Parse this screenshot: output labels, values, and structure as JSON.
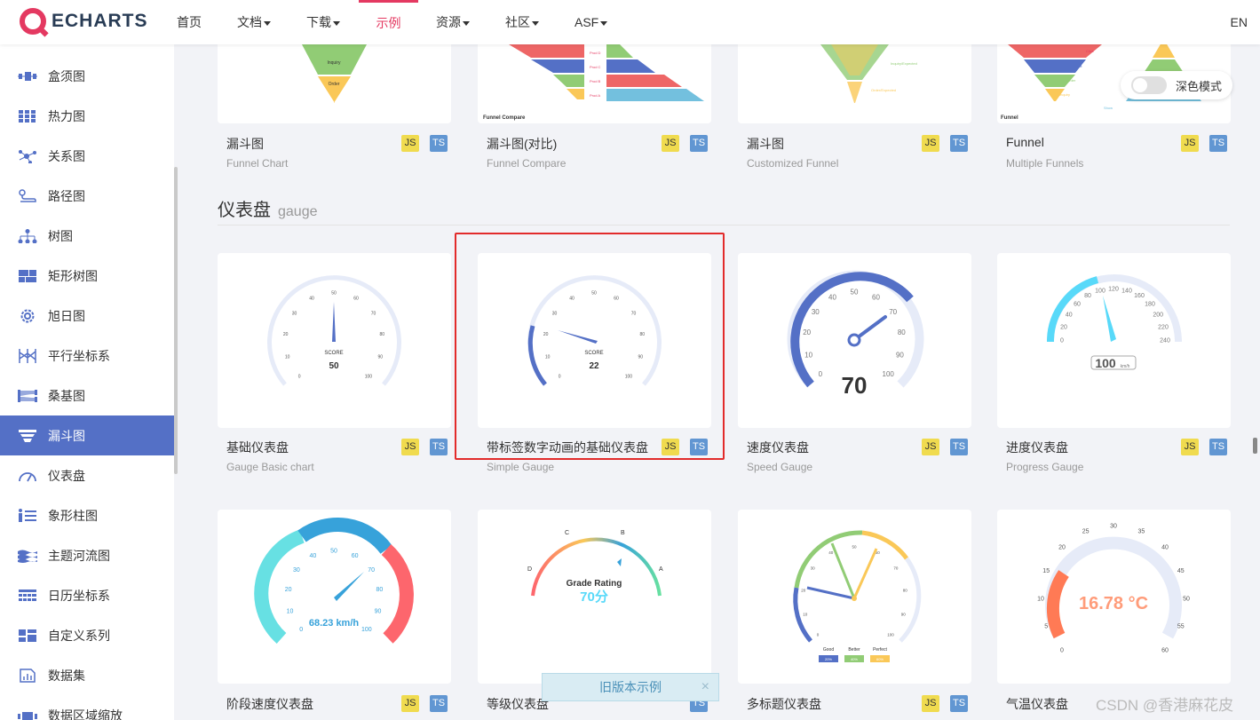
{
  "nav": {
    "logo": "ECHARTS",
    "items": [
      {
        "label": "首页"
      },
      {
        "label": "文档"
      },
      {
        "label": "下载"
      },
      {
        "label": "示例"
      },
      {
        "label": "资源"
      },
      {
        "label": "社区"
      },
      {
        "label": "ASF"
      }
    ],
    "active": "示例",
    "lang": "EN"
  },
  "sidebar": {
    "items": [
      {
        "label": "盒须图",
        "icon": "boxplot-icon"
      },
      {
        "label": "热力图",
        "icon": "heatmap-icon"
      },
      {
        "label": "关系图",
        "icon": "graph-icon"
      },
      {
        "label": "路径图",
        "icon": "lines-icon"
      },
      {
        "label": "树图",
        "icon": "tree-icon"
      },
      {
        "label": "矩形树图",
        "icon": "treemap-icon"
      },
      {
        "label": "旭日图",
        "icon": "sunburst-icon"
      },
      {
        "label": "平行坐标系",
        "icon": "parallel-icon"
      },
      {
        "label": "桑基图",
        "icon": "sankey-icon"
      },
      {
        "label": "漏斗图",
        "icon": "funnel-icon"
      },
      {
        "label": "仪表盘",
        "icon": "gauge-icon"
      },
      {
        "label": "象形柱图",
        "icon": "pictorial-bar-icon"
      },
      {
        "label": "主题河流图",
        "icon": "theme-river-icon"
      },
      {
        "label": "日历坐标系",
        "icon": "calendar-icon"
      },
      {
        "label": "自定义系列",
        "icon": "custom-icon"
      },
      {
        "label": "数据集",
        "icon": "dataset-icon"
      },
      {
        "label": "数据区域缩放",
        "icon": "datazoom-icon"
      }
    ],
    "active": "漏斗图"
  },
  "dark_mode": {
    "label": "深色模式",
    "on": false
  },
  "badges": {
    "js": "JS",
    "ts": "TS"
  },
  "funnel_cards": [
    {
      "title": "漏斗图",
      "subtitle": "Funnel Chart",
      "labels": [
        "Inquiry",
        "Order"
      ]
    },
    {
      "title": "漏斗图(对比)",
      "subtitle": "Funnel Compare",
      "chart_title": "Funnel Compare",
      "labels": [
        "Prod D",
        "Prod C",
        "Prod B",
        "Prod A"
      ]
    },
    {
      "title": "漏斗图",
      "subtitle": "Customized Funnel",
      "labels": [
        "Inquiry/Expected",
        "Order/Expected"
      ]
    },
    {
      "title": "Funnel",
      "subtitle": "Multiple Funnels",
      "chart_title": "Funnel",
      "labels": [
        "Click",
        "Visit",
        "Order",
        "Inquiry",
        "Show"
      ]
    }
  ],
  "section": {
    "title": "仪表盘",
    "subtitle": "gauge"
  },
  "gauge_cards_row1": [
    {
      "title": "基础仪表盘",
      "subtitle": "Gauge Basic chart",
      "label": "SCORE",
      "value": "50"
    },
    {
      "title": "带标签数字动画的基础仪表盘",
      "subtitle": "Simple Gauge",
      "label": "SCORE",
      "value": "22"
    },
    {
      "title": "速度仪表盘",
      "subtitle": "Speed Gauge",
      "value": "70"
    },
    {
      "title": "进度仪表盘",
      "subtitle": "Progress Gauge",
      "value": "100",
      "unit": "km/h"
    }
  ],
  "gauge_cards_row2": [
    {
      "title": "阶段速度仪表盘",
      "value": "68.23 km/h"
    },
    {
      "title": "等级仪表盘",
      "label": "Grade Rating",
      "value": "70分",
      "grades": [
        "D",
        "C",
        "B",
        "A"
      ]
    },
    {
      "title": "多标题仪表盘",
      "legend": [
        "Good",
        "Better",
        "Perfect"
      ],
      "percents": [
        "20%",
        "40%",
        "60%"
      ]
    },
    {
      "title": "气温仪表盘",
      "value": "16.78 °C"
    }
  ],
  "tick_labels": {
    "basic": [
      "0",
      "10",
      "20",
      "30",
      "40",
      "50",
      "60",
      "70",
      "80",
      "90",
      "100"
    ],
    "speed": [
      "0",
      "10",
      "20",
      "30",
      "40",
      "50",
      "60",
      "70",
      "80",
      "90",
      "100"
    ],
    "progress": [
      "0",
      "20",
      "40",
      "60",
      "80",
      "100",
      "120",
      "140",
      "160",
      "180",
      "200",
      "220",
      "240"
    ],
    "stage": [
      "0",
      "10",
      "20",
      "30",
      "40",
      "50",
      "60",
      "70",
      "80",
      "90",
      "100"
    ],
    "temp": [
      "0",
      "5",
      "10",
      "15",
      "20",
      "25",
      "30",
      "35",
      "40",
      "45",
      "50",
      "55",
      "60"
    ]
  },
  "old_version_banner": "旧版本示例",
  "close_symbol": "×",
  "watermark": "CSDN @香港麻花皮",
  "colors": {
    "accent": "#e43961",
    "primary": "#5470c6",
    "highlight": "#e22b2b"
  }
}
